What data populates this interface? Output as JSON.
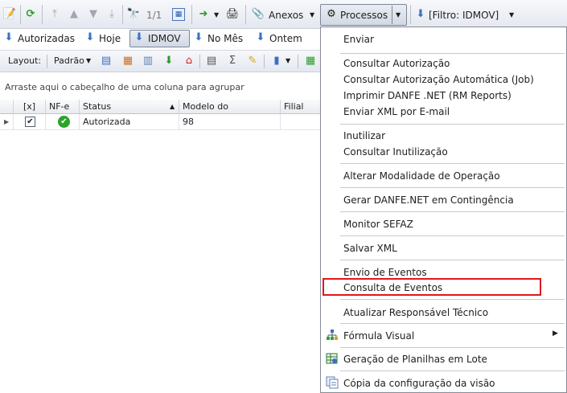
{
  "toolbar": {
    "page_counter": "1/1",
    "anexos_label": "Anexos",
    "processos_label": "Processos",
    "filter_label": "[Filtro: IDMOV]"
  },
  "filters": {
    "autorizadas": "Autorizadas",
    "hoje": "Hoje",
    "idmov": "IDMOV",
    "no_mes": "No Mês",
    "ontem": "Ontem"
  },
  "layout_bar": {
    "layout_label": "Layout:",
    "layout_value": "Padrão"
  },
  "grid": {
    "group_hint": "Arraste aqui o cabeçalho de uma coluna para agrupar",
    "columns": [
      "[x]",
      "NF-e",
      "Status",
      "Modelo do Documento",
      "Filial Emit"
    ],
    "rows": [
      {
        "status": "Autorizada",
        "modelo": "98"
      }
    ]
  },
  "menu": {
    "items": [
      "Enviar",
      "Consultar Autorização",
      "Consultar Autorização Automática (Job)",
      "Imprimir DANFE .NET (RM Reports)",
      "Enviar XML por E-mail",
      "Inutilizar",
      "Consultar Inutilização",
      "Alterar Modalidade de Operação",
      "Gerar DANFE.NET em Contingência",
      "Monitor SEFAZ",
      "Salvar XML",
      "Envio de Eventos",
      "Consulta de Eventos",
      "Atualizar Responsável Técnico",
      "Fórmula Visual",
      "Geração de Planilhas em Lote",
      "Cópia da configuração da visão"
    ]
  },
  "colors": {
    "highlight": "#e2161d",
    "status_ok": "#2aa52a"
  }
}
